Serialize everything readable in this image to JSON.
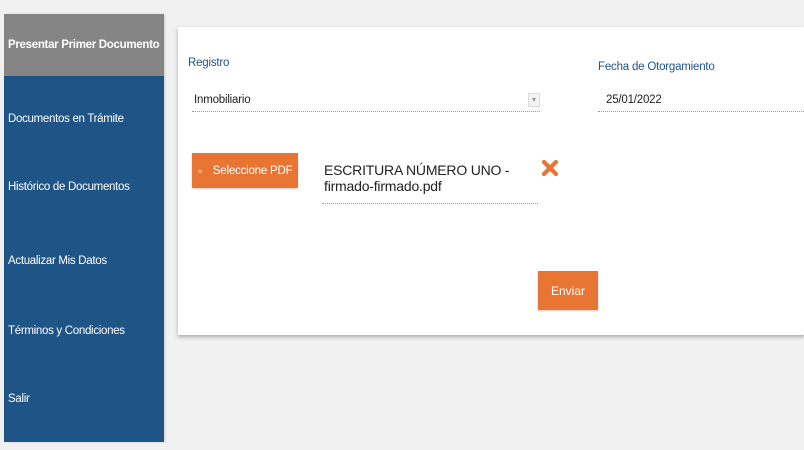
{
  "sidebar": {
    "items": [
      {
        "label": "Presentar Primer Documento",
        "active": true
      },
      {
        "label": "Documentos en Trámite",
        "active": false
      },
      {
        "label": "Histórico de Documentos",
        "active": false
      },
      {
        "label": "Actualizar Mis Datos",
        "active": false
      },
      {
        "label": "Términos y Condiciones",
        "active": false
      },
      {
        "label": "Salir",
        "active": false
      }
    ]
  },
  "form": {
    "registro_label": "Registro",
    "registro_value": "Inmobiliario",
    "fecha_label": "Fecha de Otorgamiento",
    "fecha_value": "25/01/2022",
    "select_pdf_label": "Seleccione PDF",
    "file_name": "ESCRITURA NÚMERO UNO -firmado-firmado.pdf",
    "submit_label": "Enviar"
  },
  "colors": {
    "sidebar": "#1f5487",
    "sidebar_active": "#858585",
    "accent": "#e97535",
    "label": "#1f5487"
  }
}
